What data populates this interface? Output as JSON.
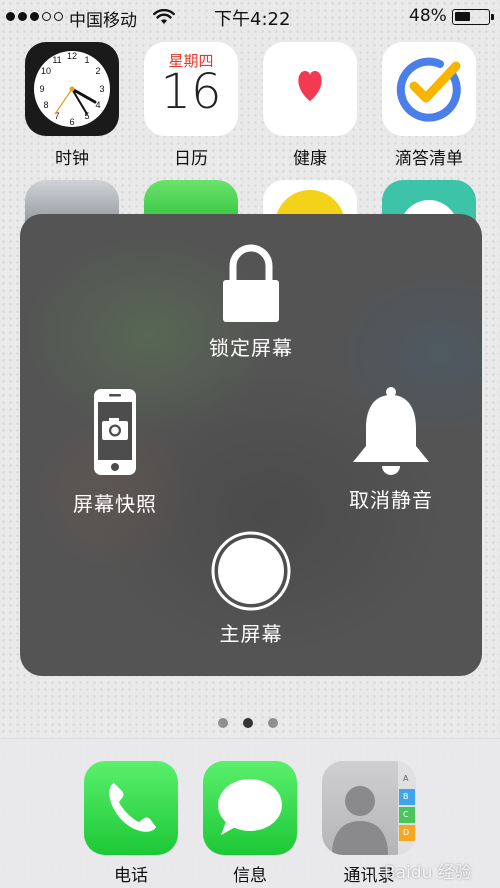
{
  "status_bar": {
    "signal_bars_filled": 3,
    "signal_bars_total": 5,
    "carrier": "中国移动",
    "wifi_icon": "wifi-icon",
    "time": "下午4:22",
    "battery_percent_text": "48%",
    "battery_level": 0.48
  },
  "home": {
    "apps_row1": [
      {
        "label": "时钟",
        "icon": "clock-icon"
      },
      {
        "label": "日历",
        "icon": "calendar-icon",
        "weekday": "星期四",
        "day": "16"
      },
      {
        "label": "健康",
        "icon": "heart-icon"
      },
      {
        "label": "滴答清单",
        "icon": "checkmark-icon"
      }
    ],
    "page_count": 3,
    "active_page": 2
  },
  "assistive_touch": {
    "lock_screen": {
      "label": "锁定屏幕",
      "icon": "lock-icon"
    },
    "screenshot": {
      "label": "屏幕快照",
      "icon": "phone-camera-icon"
    },
    "unmute": {
      "label": "取消静音",
      "icon": "bell-icon"
    },
    "home": {
      "label": "主屏幕",
      "icon": "home-button-icon"
    }
  },
  "dock": {
    "apps": [
      {
        "label": "电话",
        "icon": "phone-icon"
      },
      {
        "label": "信息",
        "icon": "message-bubble-icon"
      },
      {
        "label": "通讯录",
        "icon": "contacts-icon"
      }
    ],
    "contacts_tabs": [
      "A",
      "B",
      "C",
      "D"
    ]
  },
  "watermark": "Baidu 经验",
  "colors": {
    "panel_bg": "#545454",
    "calendar_red": "#e8392e",
    "health_red": "#f43a52",
    "todo_blue": "#4a7ee8",
    "todo_yellow": "#f7b500",
    "ios_green": "#1cc836"
  }
}
